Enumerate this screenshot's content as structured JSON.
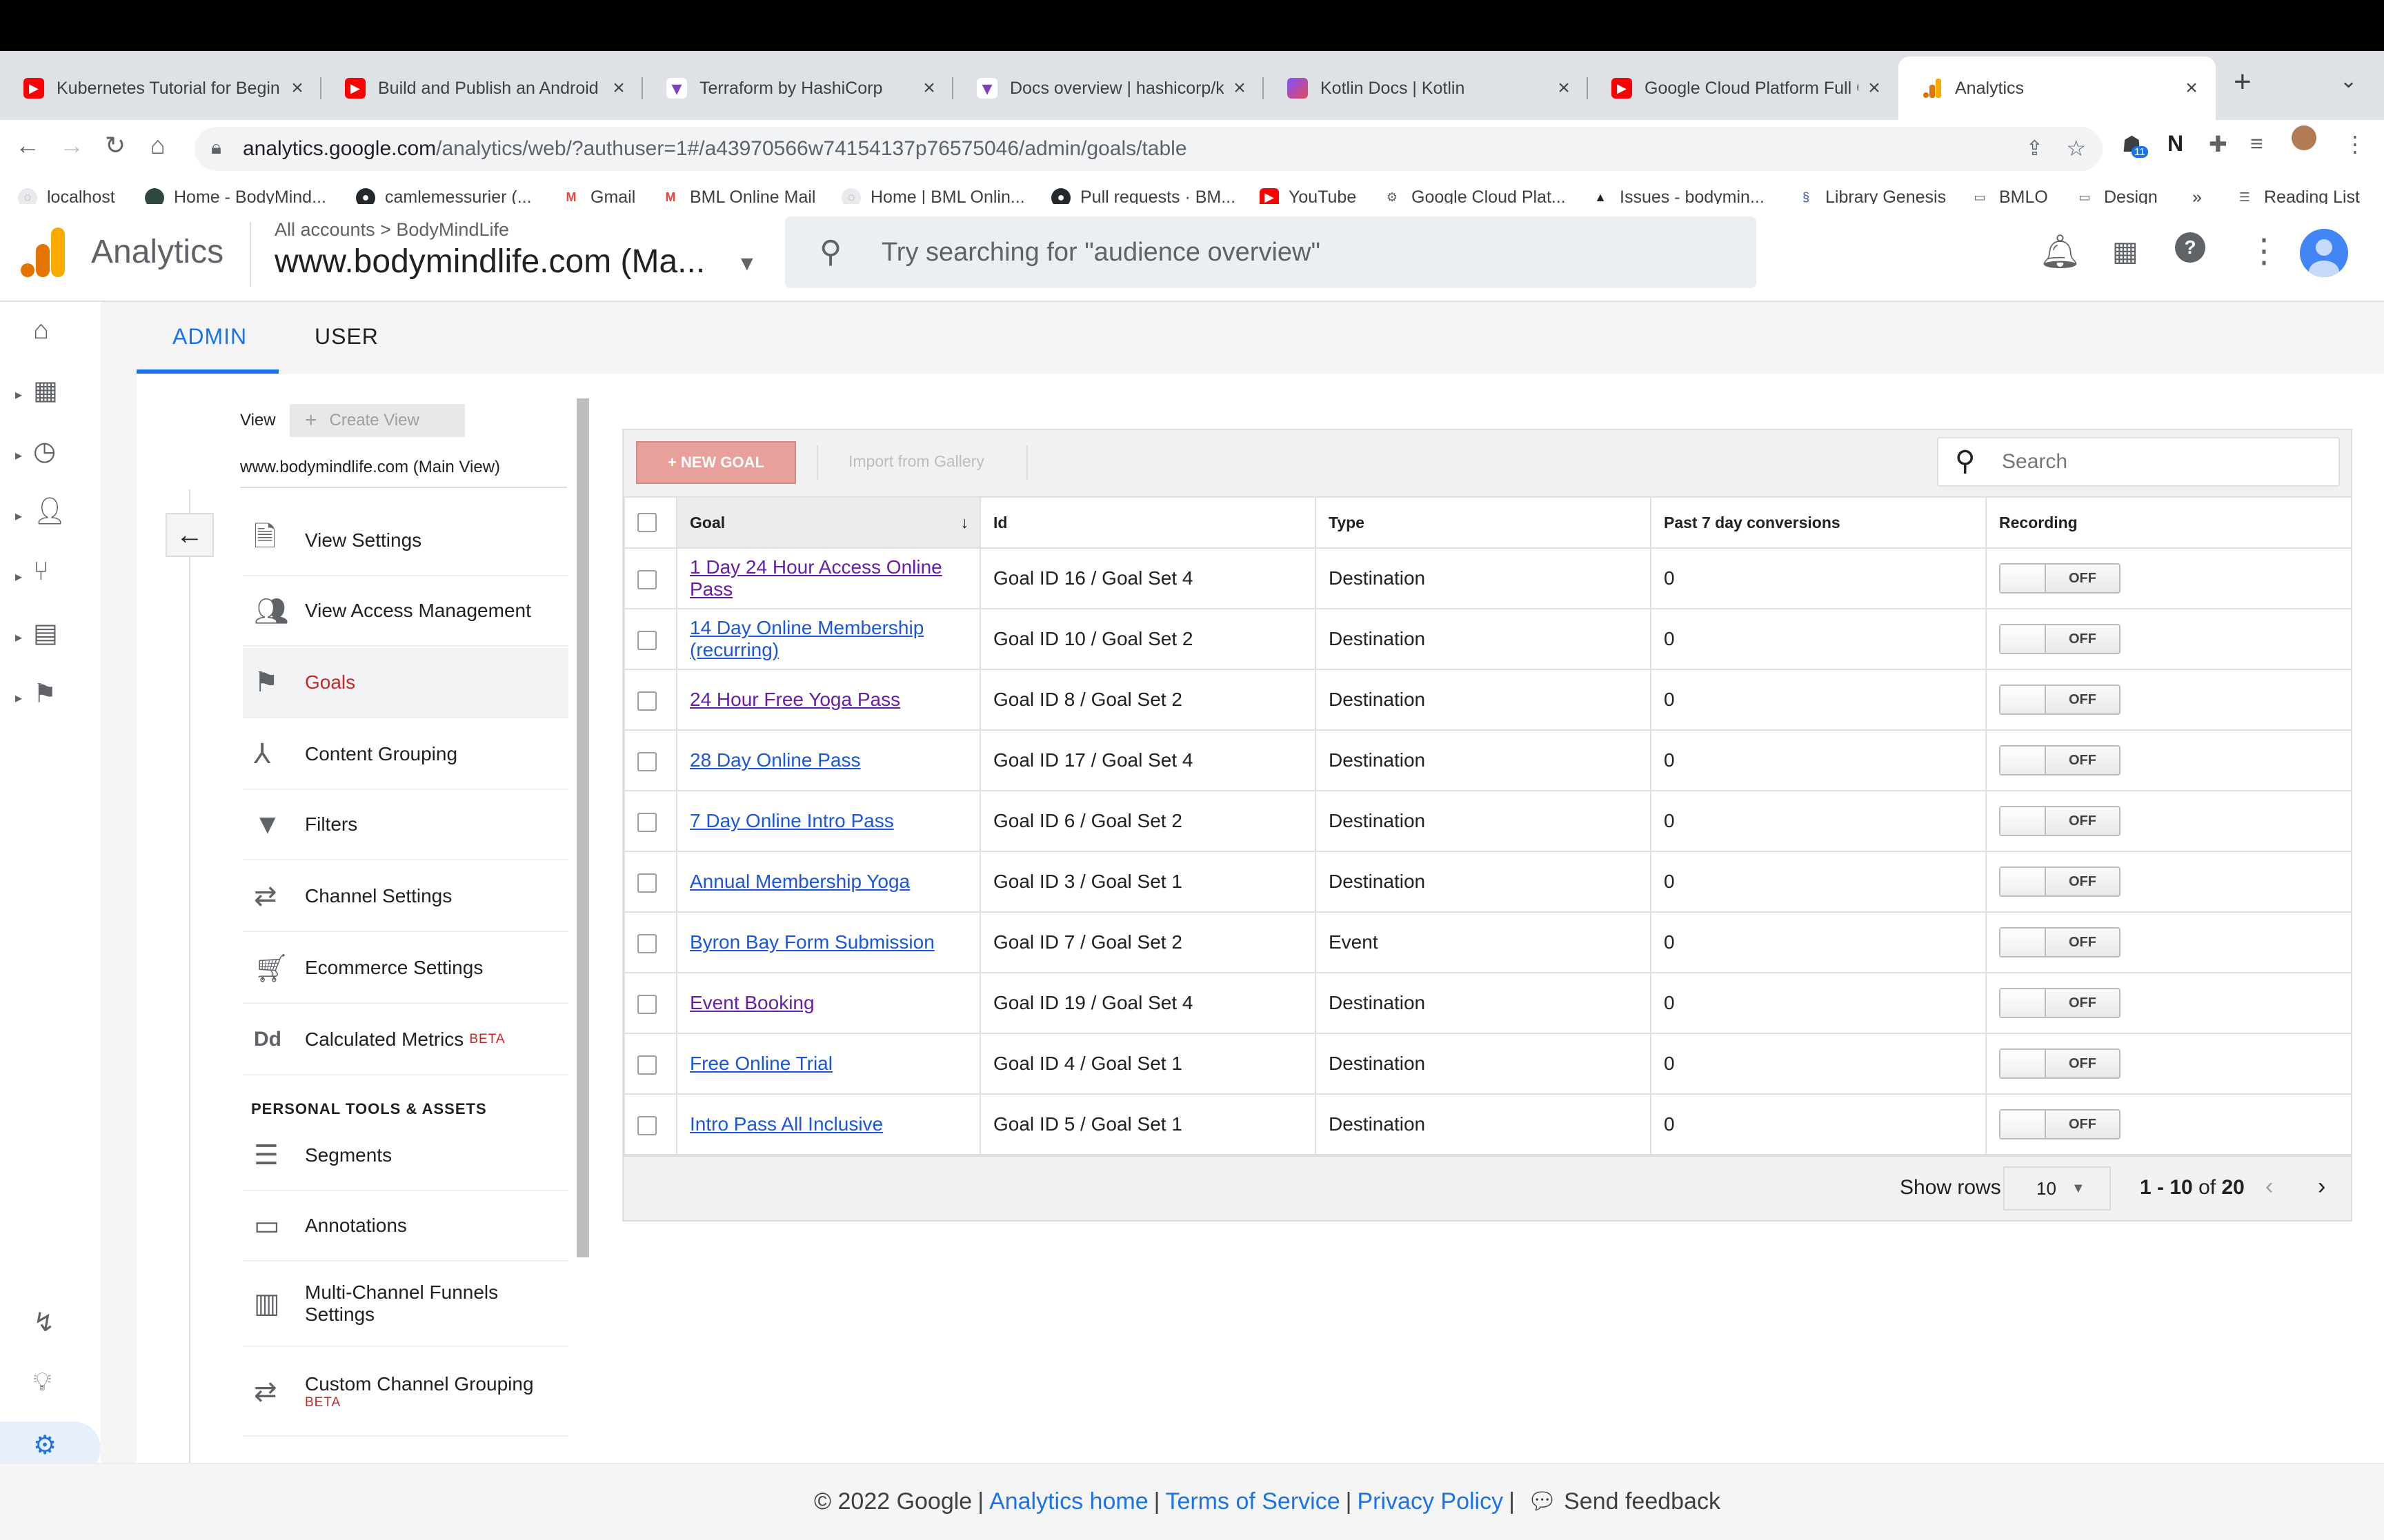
{
  "browser": {
    "tabs": [
      {
        "title": "Kubernetes Tutorial for Begin",
        "favicon": "youtube-icon"
      },
      {
        "title": "Build and Publish an Android",
        "favicon": "youtube-icon"
      },
      {
        "title": "Terraform by HashiCorp",
        "favicon": "terraform-icon"
      },
      {
        "title": "Docs overview | hashicorp/ku",
        "favicon": "terraform-icon"
      },
      {
        "title": "Kotlin Docs | Kotlin",
        "favicon": "kotlin-icon"
      },
      {
        "title": "Google Cloud Platform Full C",
        "favicon": "youtube-icon"
      },
      {
        "title": "Analytics",
        "favicon": "analytics-icon",
        "active": true
      }
    ],
    "url_domain": "analytics.google.com",
    "url_path": "/analytics/web/?authuser=1#/a43970566w74154137p76575046/admin/goals/table",
    "extension_badge": "11",
    "bookmarks": [
      {
        "label": "localhost"
      },
      {
        "label": "Home - BodyMind..."
      },
      {
        "label": "camlemessurier (..."
      },
      {
        "label": "Gmail"
      },
      {
        "label": "BML Online Mail"
      },
      {
        "label": "Home | BML Onlin..."
      },
      {
        "label": "Pull requests · BM..."
      },
      {
        "label": "YouTube"
      },
      {
        "label": "Google Cloud Plat..."
      },
      {
        "label": "Issues - bodymin..."
      },
      {
        "label": "Library Genesis"
      },
      {
        "label": "BMLO"
      },
      {
        "label": "Design"
      }
    ],
    "bookmarks_more": "»",
    "reading_list": "Reading List"
  },
  "header": {
    "app_title": "Analytics",
    "crumb_all": "All accounts",
    "crumb_sep": ">",
    "crumb_account": "BodyMindLife",
    "property": "www.bodymindlife.com (Ma...",
    "search_placeholder": "Try searching for \"audience overview\""
  },
  "admin_tabs": {
    "admin": "ADMIN",
    "user": "USER"
  },
  "view_column": {
    "view_label": "View",
    "create_view": "Create View",
    "view_name": "www.bodymindlife.com (Main View)",
    "items": [
      {
        "label": "View Settings",
        "icon": "document-icon"
      },
      {
        "label": "View Access Management",
        "icon": "people-icon"
      },
      {
        "label": "Goals",
        "icon": "flag-icon",
        "selected": true
      },
      {
        "label": "Content Grouping",
        "icon": "content-grouping-icon"
      },
      {
        "label": "Filters",
        "icon": "filter-icon"
      },
      {
        "label": "Channel Settings",
        "icon": "channel-settings-icon"
      },
      {
        "label": "Ecommerce Settings",
        "icon": "cart-icon"
      },
      {
        "label": "Calculated Metrics",
        "icon": "calculated-metrics-icon",
        "badge": "BETA"
      }
    ],
    "personal_heading": "PERSONAL TOOLS & ASSETS",
    "personal_items": [
      {
        "label": "Segments",
        "icon": "segments-icon"
      },
      {
        "label": "Annotations",
        "icon": "annotations-icon"
      },
      {
        "label": "Multi-Channel Funnels Settings",
        "icon": "bar-chart-icon"
      },
      {
        "label": "Custom Channel Grouping",
        "icon": "channel-grouping-icon",
        "badge": "BETA"
      }
    ]
  },
  "toolbar": {
    "new_goal": "+ NEW GOAL",
    "import": "Import from Gallery",
    "search_placeholder": "Search"
  },
  "table": {
    "columns": [
      "Goal",
      "Id",
      "Type",
      "Past 7 day conversions",
      "Recording"
    ],
    "rows": [
      {
        "goal": "1 Day 24 Hour Access Online Pass",
        "id": "Goal ID 16 / Goal Set 4",
        "type": "Destination",
        "conversions": "0",
        "recording": "OFF",
        "visited": true
      },
      {
        "goal": "14 Day Online Membership (recurring)",
        "id": "Goal ID 10 / Goal Set 2",
        "type": "Destination",
        "conversions": "0",
        "recording": "OFF",
        "visited": false
      },
      {
        "goal": "24 Hour Free Yoga Pass",
        "id": "Goal ID 8 / Goal Set 2",
        "type": "Destination",
        "conversions": "0",
        "recording": "OFF",
        "visited": true
      },
      {
        "goal": "28 Day Online Pass",
        "id": "Goal ID 17 / Goal Set 4",
        "type": "Destination",
        "conversions": "0",
        "recording": "OFF",
        "visited": false
      },
      {
        "goal": "7 Day Online Intro Pass",
        "id": "Goal ID 6 / Goal Set 2",
        "type": "Destination",
        "conversions": "0",
        "recording": "OFF",
        "visited": false
      },
      {
        "goal": "Annual Membership Yoga",
        "id": "Goal ID 3 / Goal Set 1",
        "type": "Destination",
        "conversions": "0",
        "recording": "OFF",
        "visited": false
      },
      {
        "goal": "Byron Bay Form Submission",
        "id": "Goal ID 7 / Goal Set 2",
        "type": "Event",
        "conversions": "0",
        "recording": "OFF",
        "visited": false
      },
      {
        "goal": "Event Booking",
        "id": "Goal ID 19 / Goal Set 4",
        "type": "Destination",
        "conversions": "0",
        "recording": "OFF",
        "visited": true
      },
      {
        "goal": "Free Online Trial",
        "id": "Goal ID 4 / Goal Set 1",
        "type": "Destination",
        "conversions": "0",
        "recording": "OFF",
        "visited": false
      },
      {
        "goal": "Intro Pass All Inclusive",
        "id": "Goal ID 5 / Goal Set 1",
        "type": "Destination",
        "conversions": "0",
        "recording": "OFF",
        "visited": false
      }
    ]
  },
  "pagination": {
    "show_rows": "Show rows",
    "rows_value": "10",
    "range": "1 - 10",
    "of": "of",
    "total": "20"
  },
  "footer": {
    "copyright": "© 2022 Google",
    "analytics_home": "Analytics home",
    "terms": "Terms of Service",
    "privacy": "Privacy Policy",
    "feedback": "Send feedback"
  },
  "colors": {
    "accent": "#1a73e8",
    "new_goal_button": "#e8a09a",
    "selected_menu_text": "#c62828",
    "link": "#1a56db",
    "visited_link": "#681da8"
  }
}
